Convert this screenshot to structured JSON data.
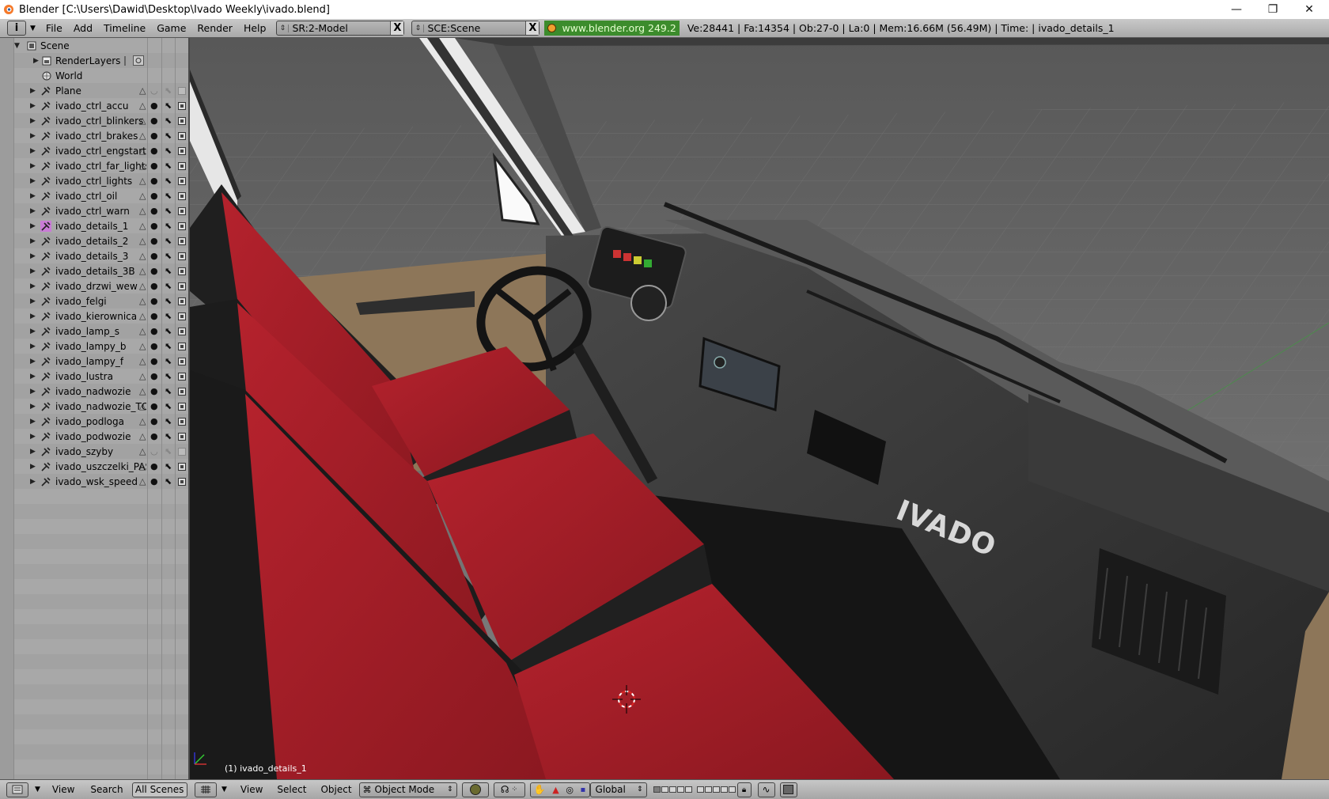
{
  "window": {
    "title": "Blender [C:\\Users\\Dawid\\Desktop\\Ivado Weekly\\ivado.blend]",
    "minimize": "—",
    "maximize": "❐",
    "close": "✕"
  },
  "info_header": {
    "menus": [
      "File",
      "Add",
      "Timeline",
      "Game",
      "Render",
      "Help"
    ],
    "screen_field": "SR:2-Model",
    "scene_field": "SCE:Scene",
    "close_glyph": "X",
    "blender_url": "www.blender.org 249.2",
    "stats": "Ve:28441 | Fa:14354 | Ob:27-0 | La:0  | Mem:16.66M (56.49M)  | Time: | ivado_details_1"
  },
  "outliner": {
    "scene": "Scene",
    "render_layers": "RenderLayers",
    "world": "World",
    "objects": [
      {
        "name": "Plane",
        "visible": false
      },
      {
        "name": "ivado_ctrl_accu",
        "visible": true
      },
      {
        "name": "ivado_ctrl_blinkers",
        "visible": true
      },
      {
        "name": "ivado_ctrl_brakes",
        "visible": true
      },
      {
        "name": "ivado_ctrl_engstart",
        "visible": true
      },
      {
        "name": "ivado_ctrl_far_lights",
        "visible": true
      },
      {
        "name": "ivado_ctrl_lights",
        "visible": true
      },
      {
        "name": "ivado_ctrl_oil",
        "visible": true
      },
      {
        "name": "ivado_ctrl_warn",
        "visible": true
      },
      {
        "name": "ivado_details_1",
        "visible": true,
        "selected": true
      },
      {
        "name": "ivado_details_2",
        "visible": true
      },
      {
        "name": "ivado_details_3",
        "visible": true
      },
      {
        "name": "ivado_details_3B",
        "visible": true
      },
      {
        "name": "ivado_drzwi_wew",
        "visible": true
      },
      {
        "name": "ivado_felgi",
        "visible": true
      },
      {
        "name": "ivado_kierownica",
        "visible": true
      },
      {
        "name": "ivado_lamp_s",
        "visible": true
      },
      {
        "name": "ivado_lampy_b",
        "visible": true
      },
      {
        "name": "ivado_lampy_f",
        "visible": true
      },
      {
        "name": "ivado_lustra",
        "visible": true
      },
      {
        "name": "ivado_nadwozie",
        "visible": true
      },
      {
        "name": "ivado_nadwozie_TO",
        "visible": true
      },
      {
        "name": "ivado_podloga",
        "visible": true
      },
      {
        "name": "ivado_podwozie",
        "visible": true
      },
      {
        "name": "ivado_szyby",
        "visible": false
      },
      {
        "name": "ivado_uszczelki_PAS",
        "visible": true
      },
      {
        "name": "ivado_wsk_speed",
        "visible": true
      }
    ]
  },
  "viewport": {
    "object_label": "(1) ivado_details_1",
    "dashboard_badge": "IVADO"
  },
  "outliner_header": {
    "view": "View",
    "search": "Search",
    "scope": "All Scenes"
  },
  "view3d_header": {
    "view": "View",
    "select": "Select",
    "object": "Object",
    "mode": "Object Mode",
    "orientation": "Global"
  },
  "colors": {
    "seat_red": "#9b1a24",
    "selected_text": "#ffffff",
    "blender_url_bg": "#3c8c2c"
  }
}
